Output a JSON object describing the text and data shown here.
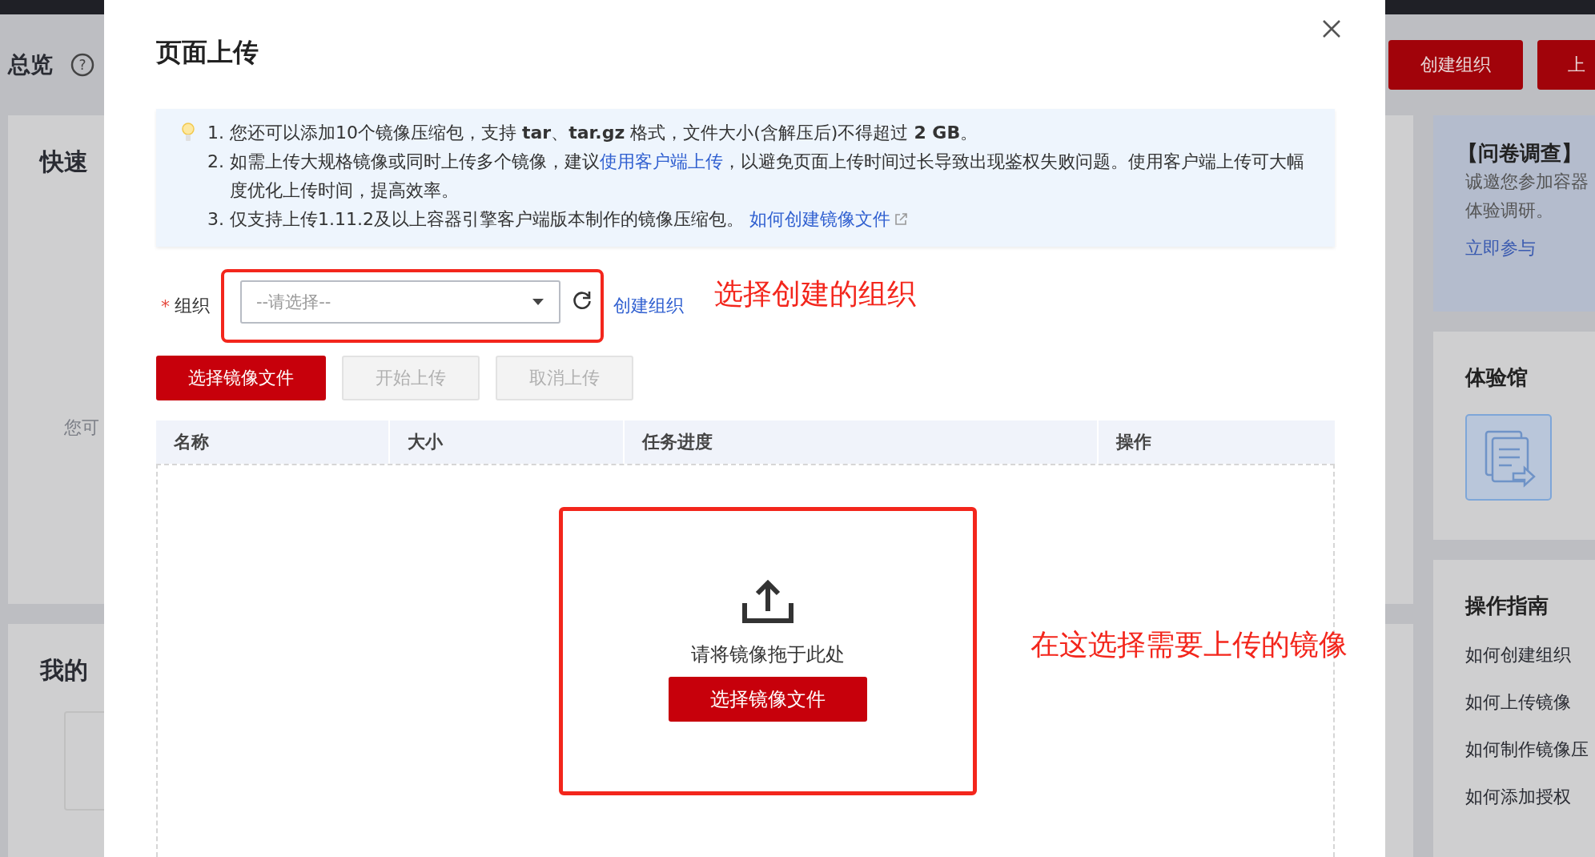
{
  "page": {
    "title": "总览",
    "help_icon": "?",
    "quick_card": {
      "title": "快速",
      "hint": "您可"
    },
    "resources_card": {
      "title": "我的"
    },
    "header_buttons": [
      "创建组织",
      "上"
    ],
    "survey": {
      "title": "【问卷调查】",
      "lines": [
        "诚邀您参加容器",
        "体验调研。"
      ],
      "link": "立即参与"
    },
    "experience": {
      "title": "体验馆"
    },
    "guide": {
      "title": "操作指南",
      "links": [
        "如何创建组织",
        "如何上传镜像",
        "如何制作镜像压",
        "如何添加授权"
      ]
    }
  },
  "dialog": {
    "title": "页面上传",
    "notice": [
      {
        "number": "1.",
        "before": "您还可以添加10个镜像压缩包，支持 **tar**、**tar.gz** 格式，文件大小(含解压后)不得超过 **2 GB**。"
      },
      {
        "number": "2.",
        "before": "如需上传大规格镜像或同时上传多个镜像，建议",
        "link": "使用客户端上传",
        "after": "，以避免页面上传时间过长导致出现鉴权失败问题。使用客户端上传可大幅度优化上传时间，提高效率。"
      },
      {
        "number": "3.",
        "before": "仅支持上传1.11.2及以上容器引擎客户端版本制作的镜像压缩包。 ",
        "link": "如何创建镜像文件",
        "external": true
      }
    ],
    "form": {
      "label": "组织",
      "required_mark": "*",
      "select": {
        "placeholder": "--请选择--"
      },
      "create_link": "创建组织",
      "annotation": "选择创建的组织"
    },
    "buttons": [
      {
        "label": "选择镜像文件",
        "kind": "primary",
        "disabled": false
      },
      {
        "label": "开始上传",
        "kind": "default",
        "disabled": true
      },
      {
        "label": "取消上传",
        "kind": "default",
        "disabled": true
      }
    ],
    "table": {
      "columns": [
        "名称",
        "大小",
        "任务进度",
        "操作"
      ]
    },
    "dropzone": {
      "hint": "请将镜像拖于此处",
      "button": "选择镜像文件",
      "annotation": "在这选择需要上传的镜像"
    }
  }
}
